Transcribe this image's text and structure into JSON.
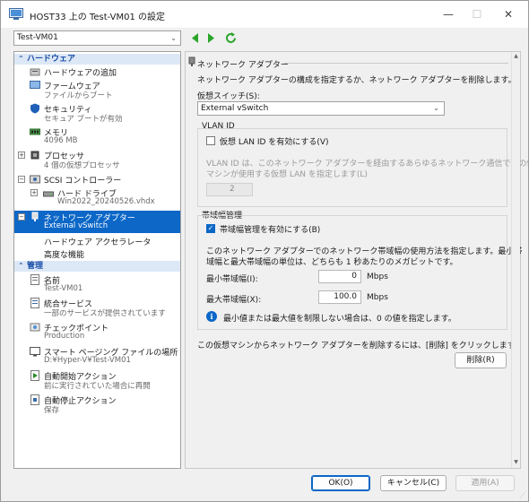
{
  "window": {
    "title": "HOST33 上の Test-VM01 の設定",
    "minimize": "—",
    "maximize": "☐",
    "close": "✕"
  },
  "toolbar": {
    "vm_selected": "Test-VM01"
  },
  "nav": {
    "hardware_section": "ハードウェア",
    "management_section": "管理",
    "items": [
      {
        "label": "ハードウェアの追加"
      },
      {
        "label": "ファームウェア",
        "sub": "ファイルからブート"
      },
      {
        "label": "セキュリティ",
        "sub": "セキュア ブートが有効"
      },
      {
        "label": "メモリ",
        "sub": "4096 MB"
      },
      {
        "label": "プロセッサ",
        "sub": "4 個の仮想プロセッサ"
      },
      {
        "label": "SCSI コントローラー"
      },
      {
        "label": "ハード ドライブ",
        "sub": "Win2022_20240526.vhdx"
      },
      {
        "label": "ネットワーク アダプター",
        "sub": "External vSwitch"
      },
      {
        "label": "ハードウェア アクセラレータ"
      },
      {
        "label": "高度な機能"
      }
    ],
    "mgmt_items": [
      {
        "label": "名前",
        "sub": "Test-VM01"
      },
      {
        "label": "統合サービス",
        "sub": "一部のサービスが提供されています"
      },
      {
        "label": "チェックポイント",
        "sub": "Production"
      },
      {
        "label": "スマート ページング ファイルの場所",
        "sub": "D:¥Hyper-V¥Test-VM01"
      },
      {
        "label": "自動開始アクション",
        "sub": "前に実行されていた場合に再開"
      },
      {
        "label": "自動停止アクション",
        "sub": "保存"
      }
    ]
  },
  "panel": {
    "title": "ネットワーク アダプター",
    "description": "ネットワーク アダプターの構成を指定するか、ネットワーク アダプターを削除します。",
    "vswitch_label": "仮想スイッチ(S):",
    "vswitch_value": "External vSwitch",
    "vlan_group": "VLAN ID",
    "vlan_checkbox": "仮想 LAN ID を有効にする(V)",
    "vlan_desc_1": "VLAN ID は、このネットワーク アダプターを経由するあらゆるネットワーク通信でこの仮想",
    "vlan_desc_2": "マシンが使用する仮想 LAN を指定します(L)",
    "vlan_value": "2",
    "bw_group": "帯域幅管理",
    "bw_checkbox": "帯域幅管理を有効にする(B)",
    "bw_desc_1": "このネットワーク アダプターでのネットワーク帯域幅の使用方法を指定します。最小帯",
    "bw_desc_2": "域幅と最大帯域幅の単位は、どちらも 1 秒あたりのメガビットです。",
    "min_label": "最小帯域幅(I):",
    "min_value": "0",
    "max_label": "最大帯域幅(X):",
    "max_value": "100.0",
    "unit": "Mbps",
    "info_text": "最小値または最大値を制限しない場合は、0 の値を指定します。",
    "remove_desc": "この仮想マシンからネットワーク アダプターを削除するには、[削除] をクリックします。",
    "remove_button": "削除(R)"
  },
  "footer": {
    "ok": "OK(O)",
    "cancel": "キャンセル(C)",
    "apply": "適用(A)"
  },
  "colors": {
    "accent": "#0c67c7",
    "nav_green": "#2aa52a"
  }
}
